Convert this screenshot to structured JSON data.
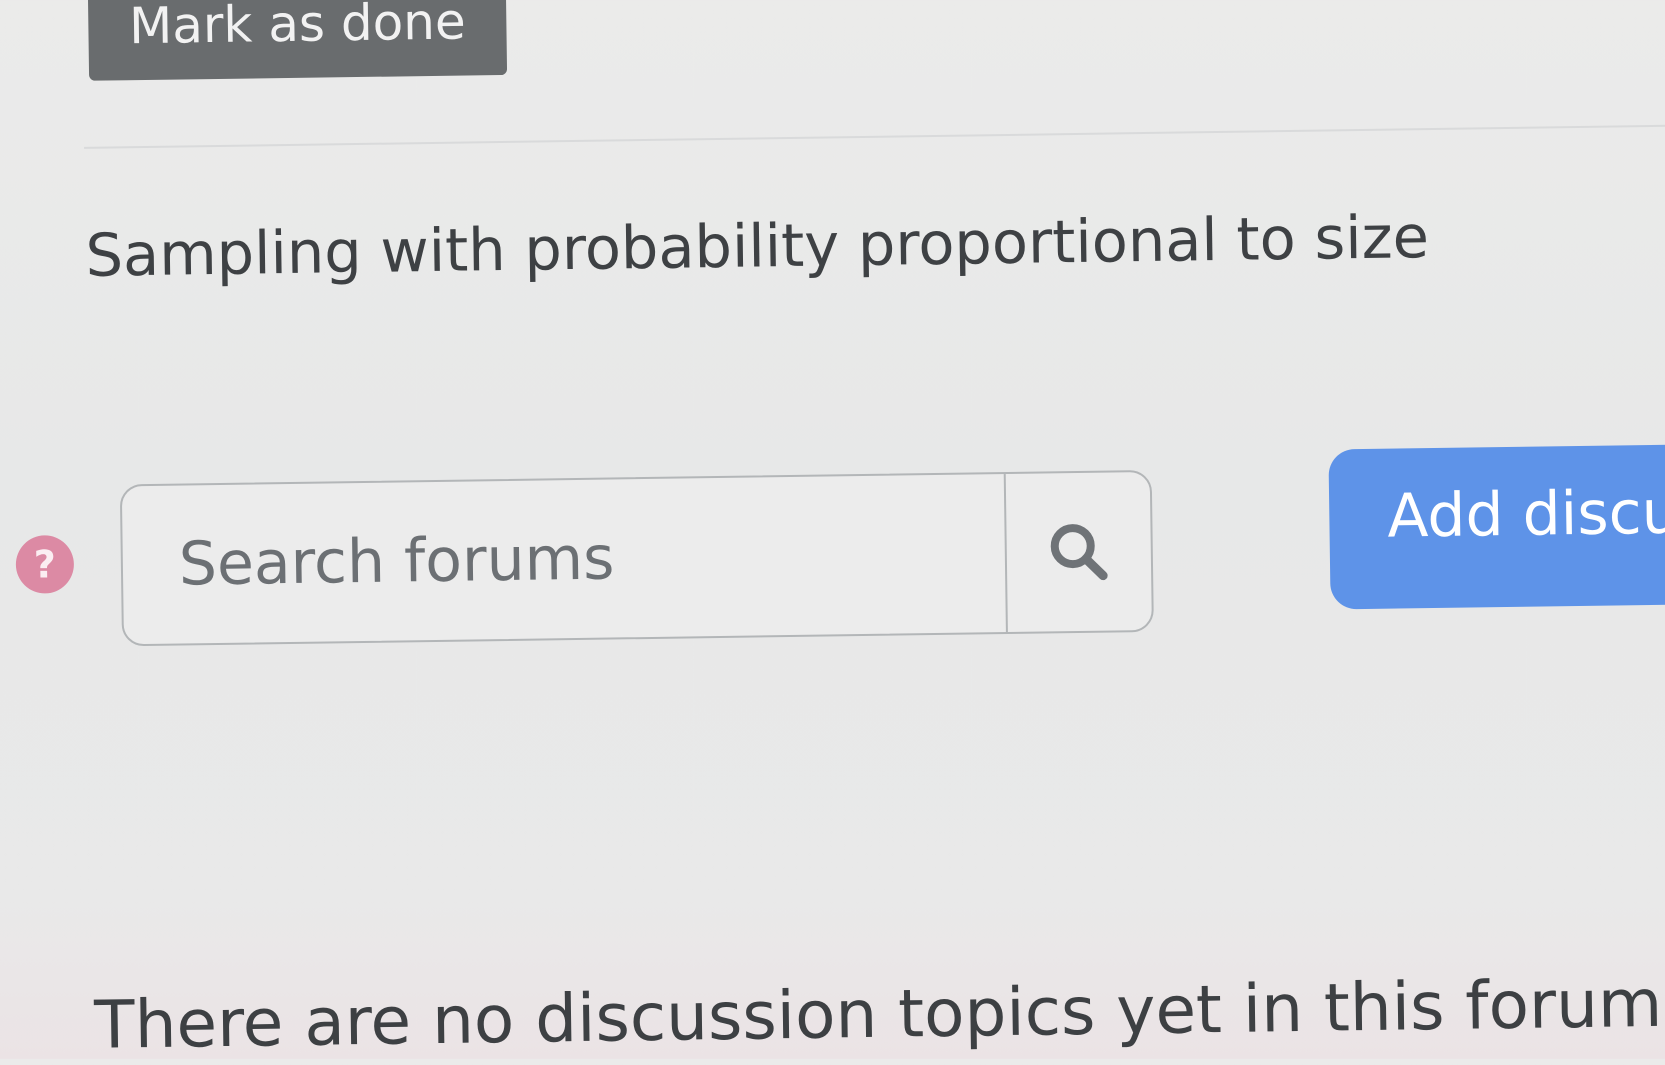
{
  "actions": {
    "mark_done_label": "Mark as done"
  },
  "activity": {
    "title": "Sampling with probability proportional to size"
  },
  "help": {
    "glyph": "?",
    "color": "#dc8aa4"
  },
  "search": {
    "placeholder": "Search forums",
    "button_icon": "search-icon"
  },
  "add_discussion": {
    "label": "Add discu",
    "color": "#5e93e8"
  },
  "forum": {
    "empty_message": "There are no discussion topics yet in this forum"
  }
}
